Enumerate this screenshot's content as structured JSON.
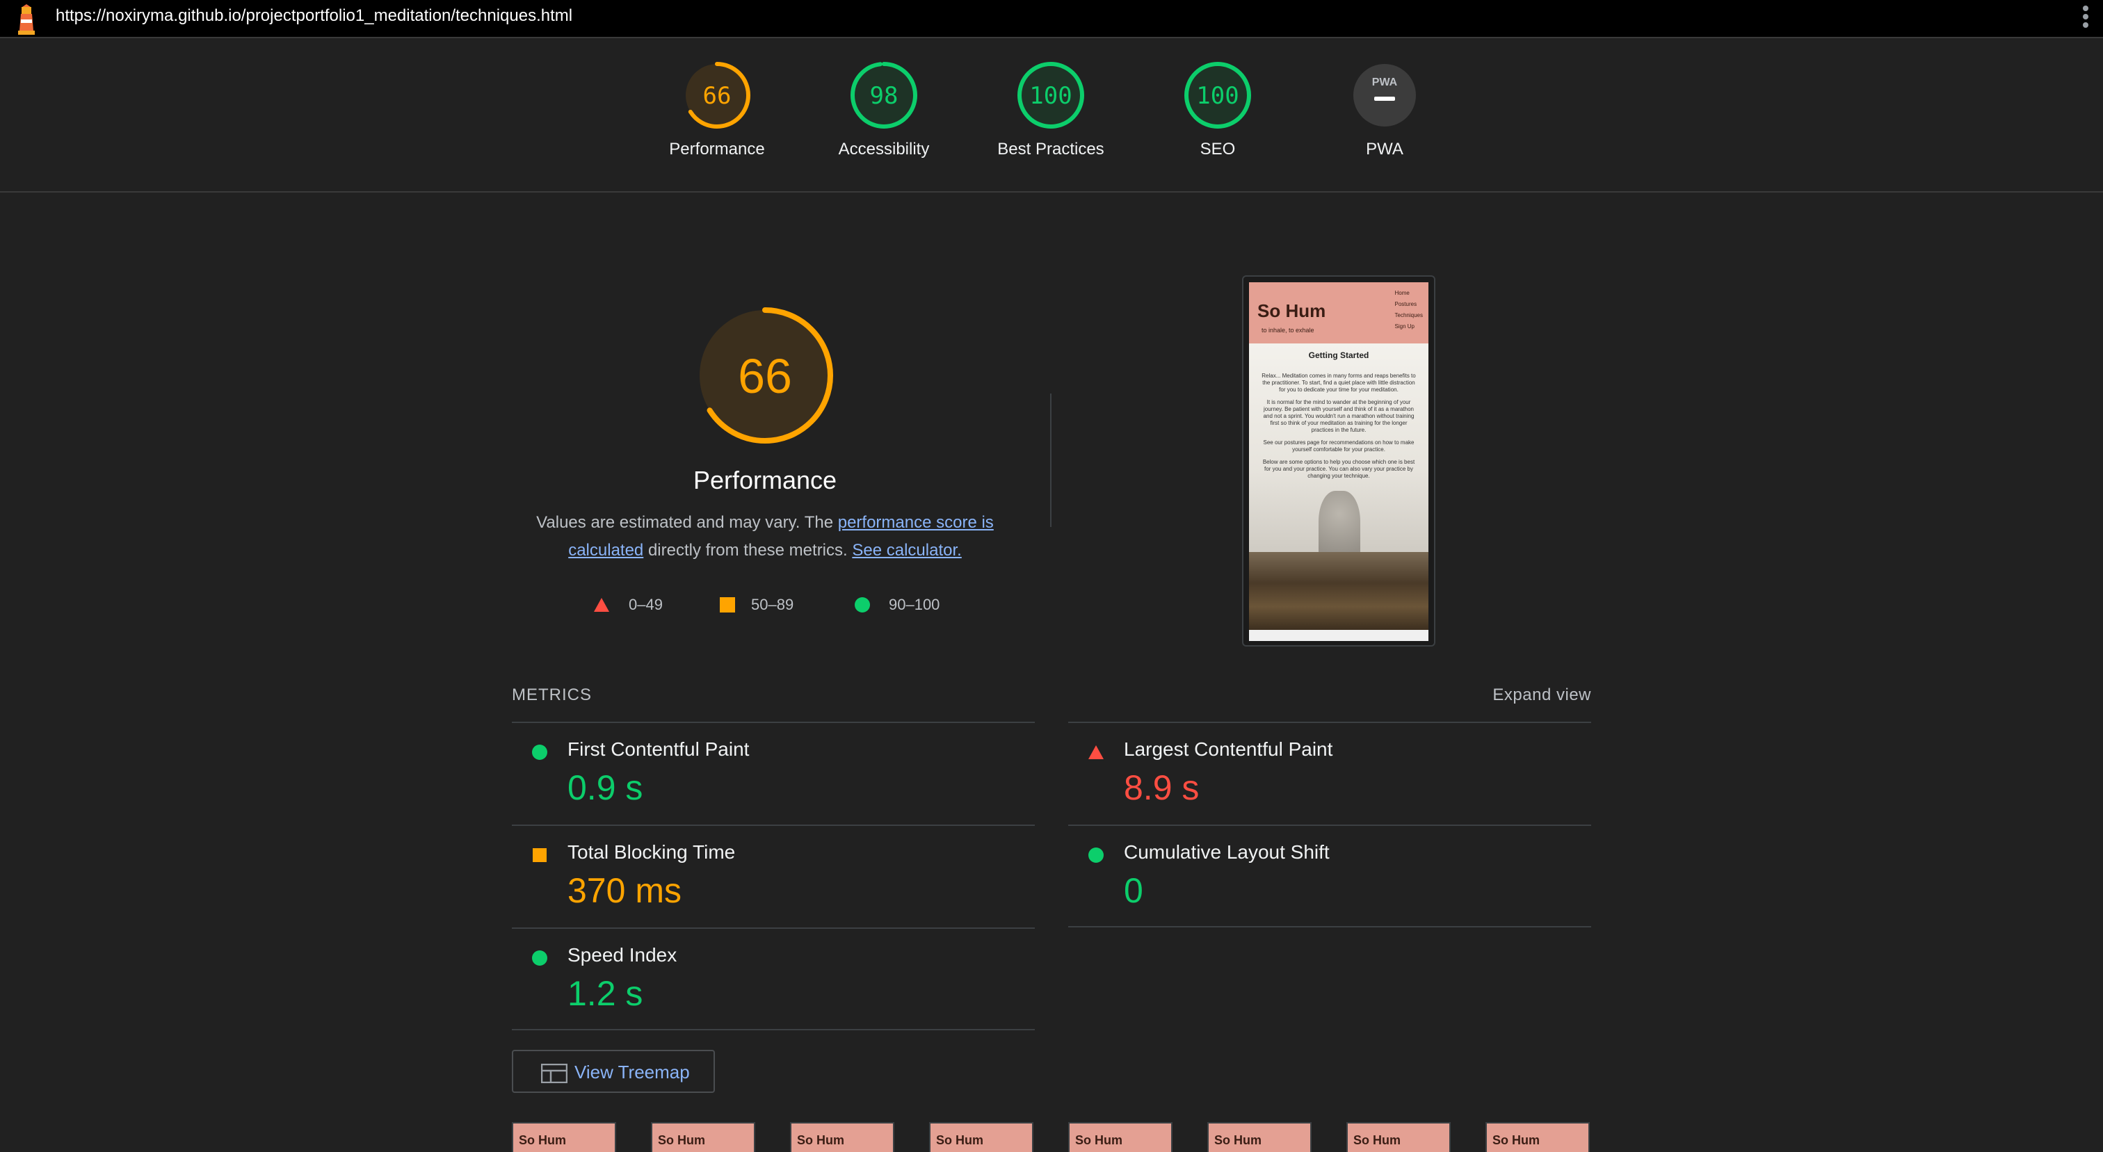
{
  "browser": {
    "url": "https://noxiryma.github.io/projectportfolio1_meditation/techniques.html",
    "logo_icon": "lighthouse-icon",
    "menu_icon": "kebab-menu-icon"
  },
  "gauges": [
    {
      "label": "Performance",
      "score": "66",
      "value": 66,
      "color": "#ffa400"
    },
    {
      "label": "Accessibility",
      "score": "98",
      "value": 98,
      "color": "#0cce6b"
    },
    {
      "label": "Best Practices",
      "score": "100",
      "value": 100,
      "color": "#0cce6b"
    },
    {
      "label": "SEO",
      "score": "100",
      "value": 100,
      "color": "#0cce6b"
    },
    {
      "label": "PWA",
      "score": "PWA",
      "value": null,
      "color": "#9aa0a6"
    }
  ],
  "performance": {
    "score": "66",
    "value": 66,
    "title": "Performance",
    "desc_prefix": "Values are estimated and may vary. The ",
    "desc_link": "performance score is calculated",
    "desc_middle": " directly from these metrics. ",
    "desc_link2": "See calculator.",
    "legend": [
      {
        "range": "0–49",
        "shape": "triangle",
        "color": "#ff4e42"
      },
      {
        "range": "50–89",
        "shape": "square",
        "color": "#ffa400"
      },
      {
        "range": "90–100",
        "shape": "circle",
        "color": "#0cce6b"
      }
    ]
  },
  "screenshot": {
    "site_title": "So Hum",
    "site_subtitle": "to inhale, to exhale",
    "nav": [
      "Home",
      "Postures",
      "Techniques",
      "Sign Up"
    ],
    "heading": "Getting Started",
    "paragraphs": [
      "Relax... Meditation comes in many forms and reaps benefits to the practitioner. To start, find a quiet place with little distraction for you to dedicate your time for your meditation.",
      "It is normal for the mind to wander at the beginning of your journey. Be patient with yourself and think of it as a marathon and not a sprint. You wouldn't run a marathon without training first so think of your meditation as training for the longer practices in the future.",
      "See our postures page for recommendations on how to make yourself comfortable for your practice.",
      "Below are some options to help you choose which one is best for you and your practice. You can also vary your practice by changing your technique."
    ]
  },
  "metrics": {
    "title": "METRICS",
    "expand_label": "Expand view",
    "items": [
      {
        "name": "First Contentful Paint",
        "value": "0.9 s",
        "rating": "pass",
        "color": "#0cce6b"
      },
      {
        "name": "Largest Contentful Paint",
        "value": "8.9 s",
        "rating": "fail",
        "color": "#ff4e42"
      },
      {
        "name": "Total Blocking Time",
        "value": "370 ms",
        "rating": "average",
        "color": "#ffa400"
      },
      {
        "name": "Cumulative Layout Shift",
        "value": "0",
        "rating": "pass",
        "color": "#0cce6b"
      },
      {
        "name": "Speed Index",
        "value": "1.2 s",
        "rating": "pass",
        "color": "#0cce6b"
      }
    ]
  },
  "treemap": {
    "label": "View Treemap",
    "icon": "treemap-icon"
  },
  "filmstrip": {
    "frames": 8,
    "frame_title": "So Hum"
  }
}
